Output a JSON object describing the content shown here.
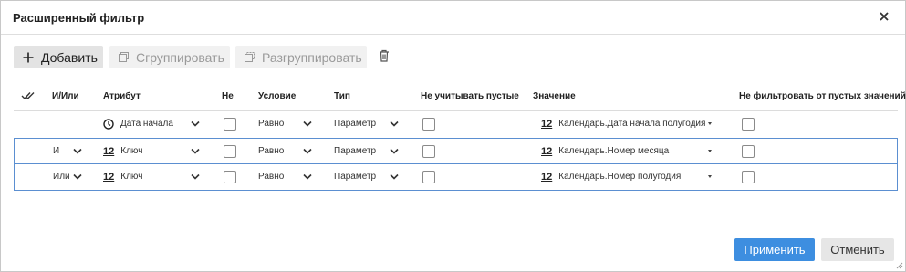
{
  "dialog": {
    "title": "Расширенный фильтр"
  },
  "toolbar": {
    "add_label": "Добавить",
    "group_label": "Сгруппировать",
    "ungroup_label": "Разгруппировать"
  },
  "columns": {
    "and_or": "И/Или",
    "attribute": "Атрибут",
    "not": "Не",
    "condition": "Условие",
    "type": "Тип",
    "ignore_empty": "Не учитывать пустые",
    "value": "Значение",
    "no_filter_empty": "Не фильтровать от пустых значений"
  },
  "rows": [
    {
      "logic": "",
      "attribute": "Дата начала",
      "attribute_icon": "clock-icon",
      "condition": "Равно",
      "type": "Параметр",
      "value_type": "12",
      "value": "Календарь.Дата начала полугодия"
    },
    {
      "logic": "И",
      "attribute_type": "12",
      "attribute": "Ключ",
      "condition": "Равно",
      "type": "Параметр",
      "value_type": "12",
      "value": "Календарь.Номер месяца"
    },
    {
      "logic": "Или",
      "attribute_type": "12",
      "attribute": "Ключ",
      "condition": "Равно",
      "type": "Параметр",
      "value_type": "12",
      "value": "Календарь.Номер полугодия"
    }
  ],
  "footer": {
    "apply_label": "Применить",
    "cancel_label": "Отменить"
  },
  "colors": {
    "accent": "#3d8ee0",
    "selection_border": "#5b8fd1"
  }
}
